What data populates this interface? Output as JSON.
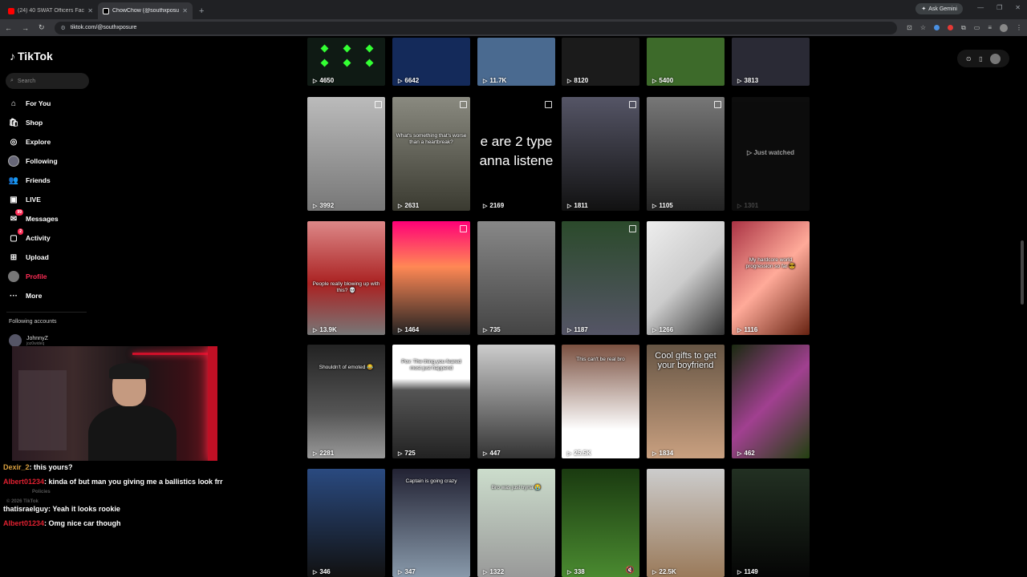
{
  "browser": {
    "tabs": [
      {
        "title": "(24) 40 SWAT Officers Face Ulti...",
        "active": false,
        "favicon": "youtube-icon",
        "favicon_color": "#ff0000"
      },
      {
        "title": "ChowChow (@southxposure) |...",
        "active": true,
        "favicon": "tiktok-icon",
        "favicon_color": "#ffffff"
      }
    ],
    "new_tab": "+",
    "ask_gemini": "Ask Gemini",
    "url": "tiktok.com/@southxposure"
  },
  "sidebar": {
    "logo": "TikTok",
    "search_placeholder": "Search",
    "items": [
      {
        "label": "For You",
        "icon": "home-icon"
      },
      {
        "label": "Shop",
        "icon": "shop-icon"
      },
      {
        "label": "Explore",
        "icon": "compass-icon"
      },
      {
        "label": "Following",
        "icon": "following-avatar-icon"
      },
      {
        "label": "Friends",
        "icon": "friends-icon"
      },
      {
        "label": "LIVE",
        "icon": "live-icon"
      },
      {
        "label": "Messages",
        "icon": "messages-icon",
        "badge": "99"
      },
      {
        "label": "Activity",
        "icon": "activity-icon",
        "badge": "2"
      },
      {
        "label": "Upload",
        "icon": "upload-icon"
      },
      {
        "label": "Profile",
        "icon": "profile-avatar-icon"
      },
      {
        "label": "More",
        "icon": "more-icon"
      }
    ],
    "following_label": "Following accounts",
    "following_accounts": [
      {
        "name": "JohnnyZ",
        "handle": "joz0wideq"
      }
    ]
  },
  "chat": {
    "messages": [
      {
        "user": "Dexir_2",
        "text": ": this yours?"
      },
      {
        "user": "Albert01234",
        "text": ": kinda of but man you giving me a ballistics look frr"
      },
      {
        "user": "thatisraelguy",
        "text": ": Yeah it looks rookie"
      },
      {
        "user": "Albert01234",
        "text": ": Omg nice car though"
      }
    ],
    "faint_text": [
      "© 2026 TikTok",
      "Policies"
    ]
  },
  "grid": {
    "rows": [
      [
        {
          "views": "4650",
          "caption": ""
        },
        {
          "views": "6642",
          "caption": ""
        },
        {
          "views": "11.7K",
          "caption": ""
        },
        {
          "views": "8120",
          "caption": ""
        },
        {
          "views": "5400",
          "caption": ""
        },
        {
          "views": "3813",
          "caption": ""
        }
      ],
      [
        {
          "views": "3992",
          "caption": ""
        },
        {
          "views": "2631",
          "caption": "What's something that's worse than a heartbreak?"
        },
        {
          "views": "2169",
          "caption": "",
          "big_lines": [
            "e are 2 type",
            "anna listene"
          ]
        },
        {
          "views": "1811",
          "caption": ""
        },
        {
          "views": "1105",
          "caption": ""
        },
        {
          "views": "1301",
          "caption": "",
          "just_watched": "Just watched"
        }
      ],
      [
        {
          "views": "13.9K",
          "caption": "People really blowing up with this? 💀"
        },
        {
          "views": "1464",
          "caption": ""
        },
        {
          "views": "735",
          "caption": ""
        },
        {
          "views": "1187",
          "caption": ""
        },
        {
          "views": "1266",
          "caption": ""
        },
        {
          "views": "1116",
          "caption": "My hardcore world progression so far 😎"
        }
      ],
      [
        {
          "views": "2281",
          "caption": "Shouldn't of emoted 😂"
        },
        {
          "views": "725",
          "caption": "Pov: The thing you feared most just happend"
        },
        {
          "views": "447",
          "caption": ""
        },
        {
          "views": "25.5K",
          "caption": "This can't be real bro"
        },
        {
          "views": "1834",
          "caption": "Cool gifts to get your boyfriend"
        },
        {
          "views": "462",
          "caption": ""
        }
      ],
      [
        {
          "views": "346",
          "caption": ""
        },
        {
          "views": "347",
          "caption": "Captain is going crazy"
        },
        {
          "views": "1322",
          "caption": "Bro was just tryna 😭"
        },
        {
          "views": "338",
          "caption": ""
        },
        {
          "views": "22.5K",
          "caption": ""
        },
        {
          "views": "1149",
          "caption": ""
        }
      ]
    ]
  }
}
